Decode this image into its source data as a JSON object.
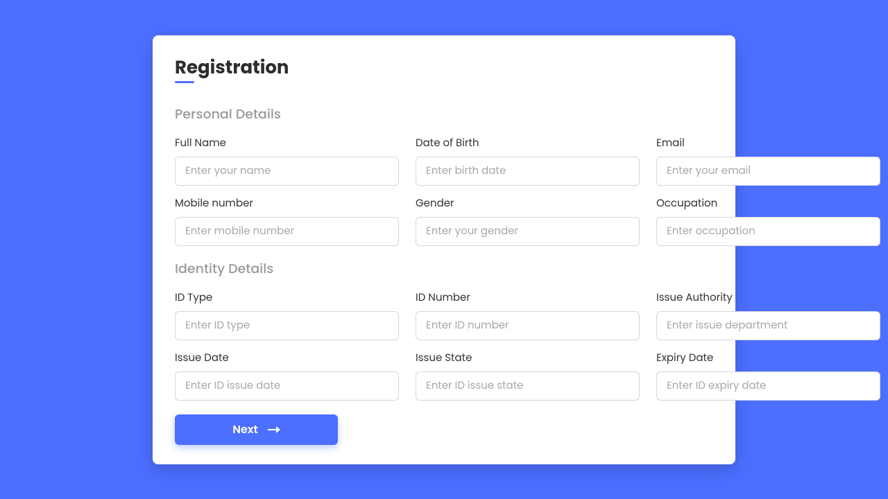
{
  "title": "Registration",
  "sections": {
    "personal": {
      "heading": "Personal Details",
      "fields": {
        "fullName": {
          "label": "Full Name",
          "placeholder": "Enter your name",
          "value": ""
        },
        "dob": {
          "label": "Date of Birth",
          "placeholder": "Enter birth date",
          "value": ""
        },
        "email": {
          "label": "Email",
          "placeholder": "Enter your email",
          "value": ""
        },
        "mobile": {
          "label": "Mobile number",
          "placeholder": "Enter mobile number",
          "value": ""
        },
        "gender": {
          "label": "Gender",
          "placeholder": "Enter your gender",
          "value": ""
        },
        "occupation": {
          "label": "Occupation",
          "placeholder": "Enter occupation",
          "value": ""
        }
      }
    },
    "identity": {
      "heading": "Identity Details",
      "fields": {
        "idType": {
          "label": "ID Type",
          "placeholder": "Enter ID type",
          "value": ""
        },
        "idNumber": {
          "label": "ID Number",
          "placeholder": "Enter ID number",
          "value": ""
        },
        "issueAuthority": {
          "label": "Issue Authority",
          "placeholder": "Enter issue department",
          "value": ""
        },
        "issueDate": {
          "label": "Issue Date",
          "placeholder": "Enter ID issue date",
          "value": ""
        },
        "issueState": {
          "label": "Issue State",
          "placeholder": "Enter ID issue state",
          "value": ""
        },
        "expiryDate": {
          "label": "Expiry Date",
          "placeholder": "Enter ID expiry date",
          "value": ""
        }
      }
    }
  },
  "nextButton": {
    "label": "Next"
  }
}
